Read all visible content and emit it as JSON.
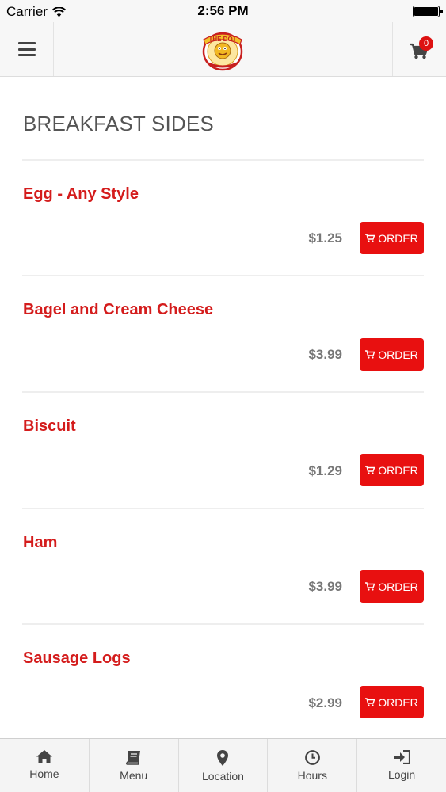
{
  "status_bar": {
    "carrier": "Carrier",
    "time": "2:56 PM"
  },
  "header": {
    "logo_text": "THE DOT",
    "cart_count": "0"
  },
  "section": {
    "title": "BREAKFAST SIDES"
  },
  "items": [
    {
      "name": "Egg - Any Style",
      "price": "$1.25",
      "button": "ORDER"
    },
    {
      "name": "Bagel and Cream Cheese",
      "price": "$3.99",
      "button": "ORDER"
    },
    {
      "name": "Biscuit",
      "price": "$1.29",
      "button": "ORDER"
    },
    {
      "name": "Ham",
      "price": "$3.99",
      "button": "ORDER"
    },
    {
      "name": "Sausage Logs",
      "price": "$2.99",
      "button": "ORDER"
    }
  ],
  "tabs": [
    {
      "label": "Home",
      "icon": "home-icon"
    },
    {
      "label": "Menu",
      "icon": "book-icon"
    },
    {
      "label": "Location",
      "icon": "map-pin-icon"
    },
    {
      "label": "Hours",
      "icon": "clock-icon"
    },
    {
      "label": "Login",
      "icon": "login-icon"
    }
  ],
  "colors": {
    "accent": "#e81010",
    "item_name": "#d41c1c",
    "price": "#777777"
  }
}
